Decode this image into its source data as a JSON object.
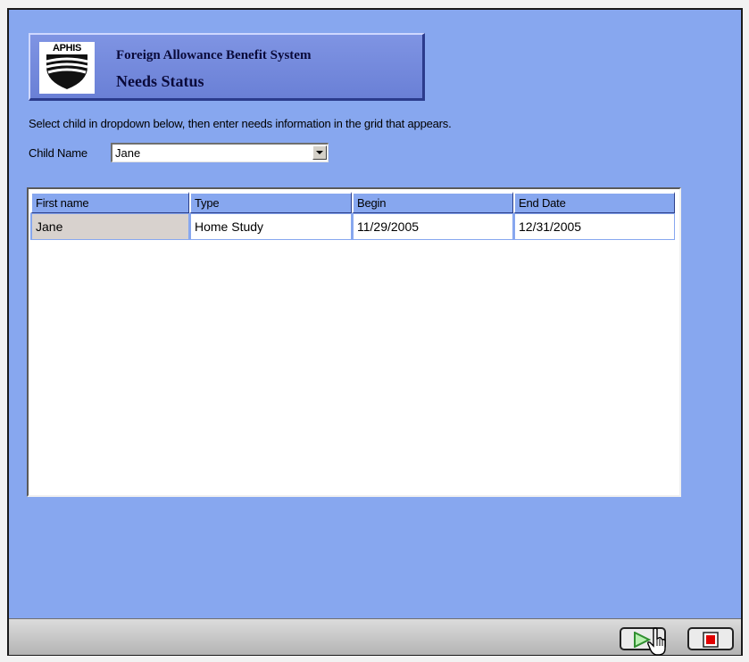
{
  "header": {
    "logo_text": "APHIS",
    "app_title": "Foreign Allowance Benefit System",
    "page_title": "Needs Status"
  },
  "form": {
    "instructions": "Select child in dropdown below, then enter needs information in the grid that appears.",
    "child_label": "Child Name",
    "child_value": "Jane"
  },
  "grid": {
    "columns": [
      "First name",
      "Type",
      "Begin",
      "End Date"
    ],
    "rows": [
      [
        "Jane",
        "Home Study",
        "11/29/2005",
        "12/31/2005"
      ]
    ]
  },
  "footer": {
    "play_icon": "play-icon",
    "stop_icon": "stop-icon"
  },
  "colors": {
    "background": "#87a7ef",
    "header_panel": "#7085d9",
    "play_green": "#3cb043",
    "stop_red": "#e00000"
  }
}
